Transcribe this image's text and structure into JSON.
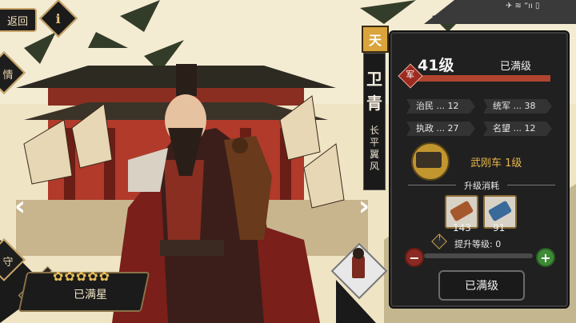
{
  "header": {
    "back_label": "返回",
    "info_label": "i",
    "status_text": "✈ ≋ “ıı ▯"
  },
  "side_tabs": [
    "情",
    "守"
  ],
  "hero": {
    "grade_badge": "天",
    "name_line1": "卫",
    "name_line2": "青",
    "title_vertical": "长平翼风",
    "stars": "✿✿✿✿✿",
    "star_status": "已满星"
  },
  "panel": {
    "level": "41级",
    "max_level": "已满级",
    "level_badge": "军",
    "level_progress": 1.0,
    "stats": [
      {
        "label": "治民 ... 12"
      },
      {
        "label": "统军 ... 38"
      },
      {
        "label": "执政 ... 27"
      },
      {
        "label": "名望 ... 12"
      }
    ],
    "equipment": "武刚车 1级",
    "cost_title": "升级消耗",
    "costs": [
      {
        "amount": "143"
      },
      {
        "amount": "91"
      }
    ],
    "upgrade_level_label": "提升等级:  0",
    "upgrade_button": "已满级"
  },
  "colors": {
    "panel_bg": "#202020",
    "accent_gold": "#e9b74a",
    "level_bar": "#b1442f"
  },
  "icons": {
    "info": "info-icon",
    "warning": "warning-icon",
    "minus": "minus-icon",
    "plus": "plus-icon"
  }
}
